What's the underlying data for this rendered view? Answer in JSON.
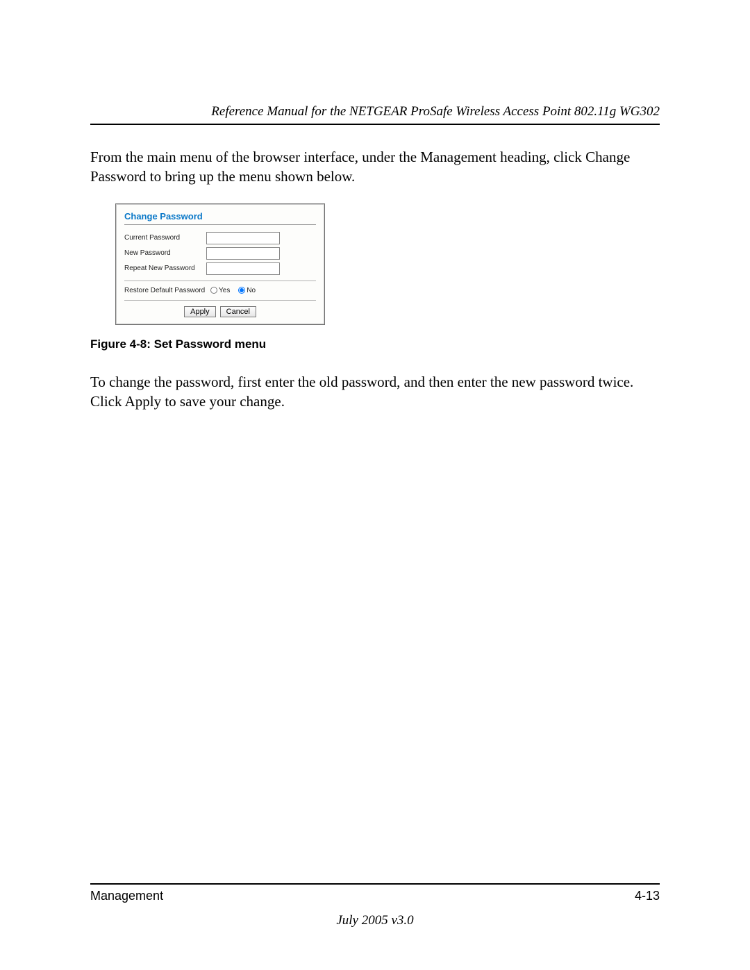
{
  "header": {
    "title": "Reference Manual for the NETGEAR ProSafe Wireless Access Point 802.11g WG302"
  },
  "paragraphs": {
    "intro": "From the main menu of the browser interface, under the Management heading, click Change Password to bring up the menu shown below.",
    "post": "To change the password, first enter the old password, and then enter the new password twice. Click Apply to save your change."
  },
  "dialog": {
    "title": "Change Password",
    "fields": {
      "current": "Current Password",
      "new": "New Password",
      "repeat": "Repeat New Password"
    },
    "restore_label": "Restore Default Password",
    "radio_yes": "Yes",
    "radio_no": "No",
    "buttons": {
      "apply": "Apply",
      "cancel": "Cancel"
    }
  },
  "figure_caption": "Figure 4-8:  Set Password menu",
  "footer": {
    "section": "Management",
    "page": "4-13",
    "date": "July 2005 v3.0"
  }
}
